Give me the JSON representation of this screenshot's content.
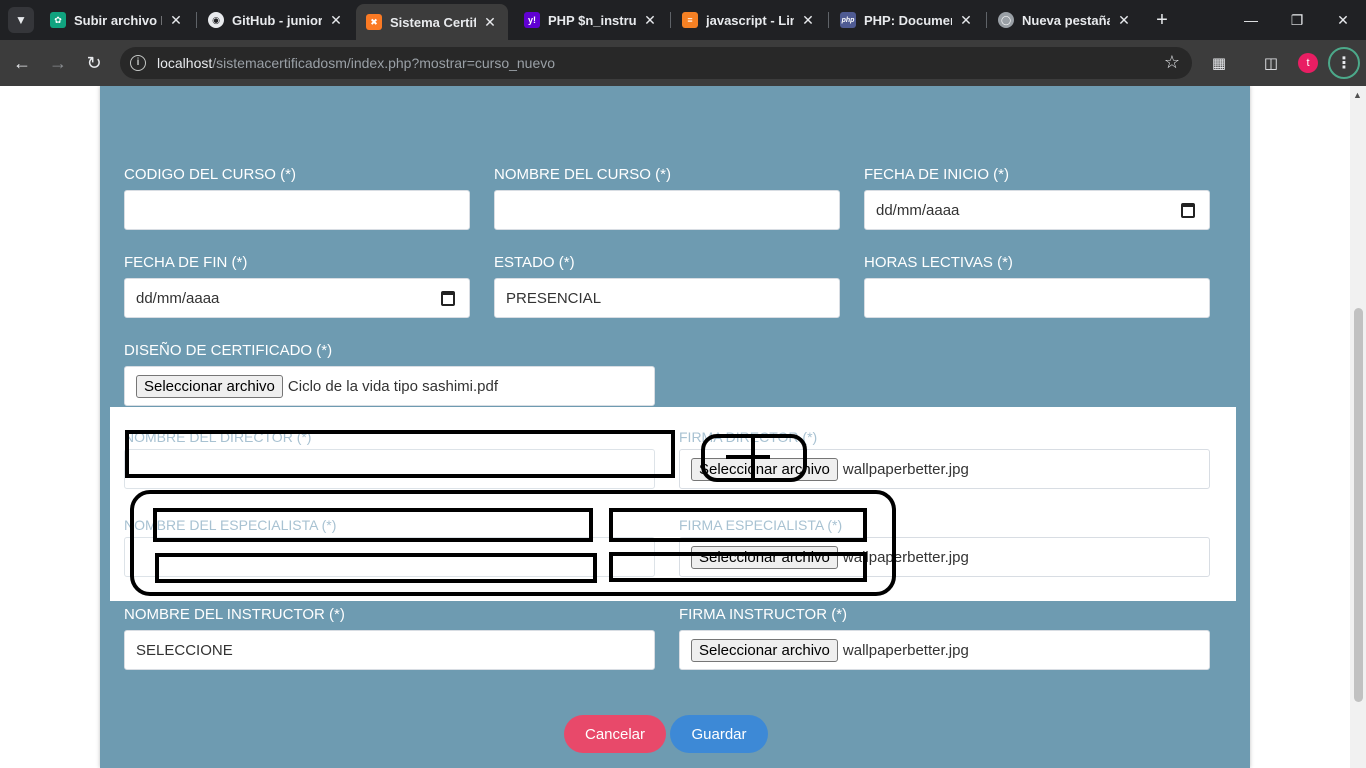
{
  "browser": {
    "tabs": [
      {
        "title": "Subir archivo HT",
        "icon": "openai-icon"
      },
      {
        "title": "GitHub - junior",
        "icon": "github-icon"
      },
      {
        "title": "Sistema Certific",
        "icon": "xampp-icon"
      },
      {
        "title": "PHP $n_instruct",
        "icon": "yahoo-icon"
      },
      {
        "title": "javascript - Limp",
        "icon": "stackoverflow-icon"
      },
      {
        "title": "PHP: Document",
        "icon": "php-icon"
      },
      {
        "title": "Nueva pestaña",
        "icon": "globe-icon"
      }
    ],
    "url_host": "localhost",
    "url_path": "/sistemacertificadosm/index.php?mostrar=curso_nuevo",
    "profile_initial": "t"
  },
  "form": {
    "codigo_label": "CODIGO DEL CURSO (*)",
    "codigo_value": "",
    "nombre_label": "NOMBRE DEL CURSO (*)",
    "nombre_value": "",
    "fecha_inicio_label": "FECHA DE INICIO (*)",
    "fecha_inicio_value": "dd/mm/aaaa",
    "fecha_fin_label": "FECHA DE FIN (*)",
    "fecha_fin_value": "dd/mm/aaaa",
    "estado_label": "ESTADO (*)",
    "estado_value": "PRESENCIAL",
    "horas_label": "HORAS LECTIVAS (*)",
    "horas_value": "",
    "diseno_label": "DISEÑO DE CERTIFICADO (*)",
    "diseno_button": "Seleccionar archivo",
    "diseno_file": "Ciclo de la vida tipo sashimi.pdf",
    "director_label": "NOMBRE DEL DIRECTOR (*)",
    "firma_director_label": "FIRMA DIRECTOR (*)",
    "firma_director_button": "Seleccionar archivo",
    "firma_director_file": "wallpaperbetter.jpg",
    "especialista_label": "NOMBRE DEL ESPECIALISTA (*)",
    "firma_especialista_label": "FIRMA ESPECIALISTA (*)",
    "firma_especialista_button": "Seleccionar archivo",
    "firma_especialista_file": "wallpaperbetter.jpg",
    "instructor_label": "NOMBRE DEL INSTRUCTOR (*)",
    "instructor_value": "SELECCIONE",
    "firma_instructor_label": "FIRMA INSTRUCTOR (*)",
    "firma_instructor_button": "Seleccionar archivo",
    "firma_instructor_file": "wallpaperbetter.jpg",
    "cancel_label": "Cancelar",
    "save_label": "Guardar"
  },
  "colors": {
    "card_bg": "#6e9bb1",
    "cancel": "#e8496a",
    "save": "#3d89d6"
  }
}
